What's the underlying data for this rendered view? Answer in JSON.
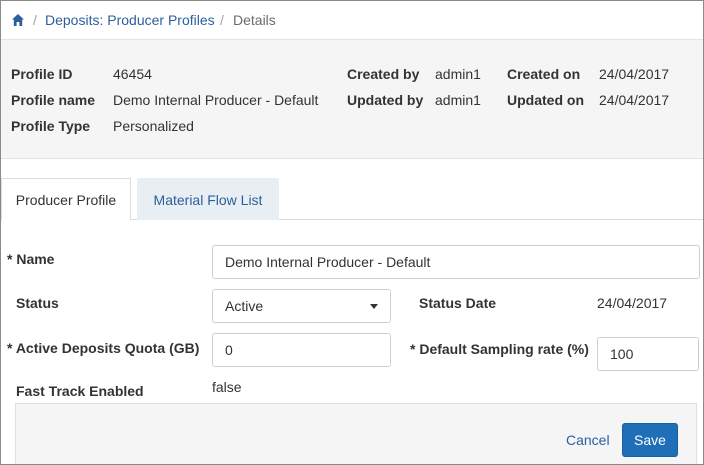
{
  "breadcrumb": {
    "home_icon": "home-icon",
    "items": [
      {
        "label": "Deposits: Producer Profiles"
      },
      {
        "label": "Details"
      }
    ],
    "separator": "/"
  },
  "profile_info": {
    "profile_id": {
      "label": "Profile ID",
      "value": "46454"
    },
    "profile_name": {
      "label": "Profile name",
      "value": "Demo Internal Producer - Default"
    },
    "profile_type": {
      "label": "Profile Type",
      "value": "Personalized"
    },
    "created_by": {
      "label": "Created by",
      "value": "admin1"
    },
    "updated_by": {
      "label": "Updated by",
      "value": "admin1"
    },
    "created_on": {
      "label": "Created on",
      "value": "24/04/2017"
    },
    "updated_on": {
      "label": "Updated on",
      "value": "24/04/2017"
    }
  },
  "tabs": [
    {
      "label": "Producer Profile",
      "active": true
    },
    {
      "label": "Material Flow List",
      "active": false
    }
  ],
  "form": {
    "name": {
      "label": "* Name",
      "value": "Demo Internal Producer - Default"
    },
    "status": {
      "label": "Status",
      "value": "Active"
    },
    "status_date": {
      "label": "Status Date",
      "value": "24/04/2017"
    },
    "quota": {
      "label": "* Active Deposits Quota (GB)",
      "value": "0"
    },
    "sampling": {
      "label": "* Default Sampling rate (%)",
      "value": "100"
    },
    "fast_track": {
      "label": "Fast Track Enabled",
      "value": "false"
    }
  },
  "actions": {
    "cancel_label": "Cancel",
    "save_label": "Save"
  },
  "colors": {
    "link": "#2c5f9e",
    "primary_button": "#1e6eb8",
    "info_background": "#f5f5f5",
    "inactive_tab": "#e9eef3"
  }
}
